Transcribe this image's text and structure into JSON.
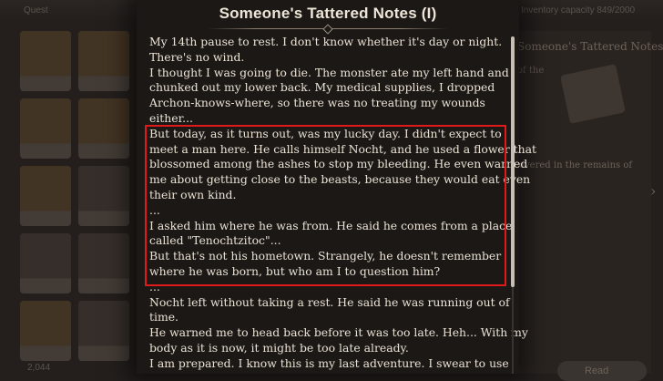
{
  "background": {
    "topbar_left": "Quest",
    "topbar_right": "Inventory capacity 849/2000",
    "detail_title": "Someone's Tattered Notes (I)",
    "detail_subtitle": "of the",
    "detail_desc": "overed in the remains of",
    "bottom_button": "Read",
    "bottom_left": "2,044"
  },
  "dialog": {
    "title": "Someone's Tattered Notes (I)",
    "lines": [
      "My 14th pause to rest. I don't know whether it's day or night.",
      "There's no wind.",
      "I thought I was going to die. The monster ate my left hand and",
      "chunked out my lower back. My medical supplies, I dropped",
      "Archon-knows-where, so there was no treating my wounds",
      "either...",
      "But today, as it turns out, was my lucky day. I didn't expect to",
      "meet a man here. He calls himself Nocht, and he used a flower that",
      "blossomed among the ashes to stop my bleeding. He even warned",
      "me about getting close to the beasts, because they would eat even",
      "their own kind.",
      "...",
      "I asked him where he was from. He said he comes from a place",
      "called \"Tenochtzitoc\"...",
      "But that's not his hometown. Strangely, he doesn't remember",
      "where he was born, but who am I to question him?",
      "...",
      "Nocht left without taking a rest. He said he was running out of",
      "time.",
      "He warned me to head back before it was too late. Heh... With my",
      "body as it is now, it might be too late already.",
      "I am prepared. I know this is my last adventure. I swear to use"
    ]
  },
  "colors": {
    "highlight": "#e01a1a",
    "text": "#ebe3d6",
    "panel": "#1c1816"
  },
  "icons": {
    "divider": "diamond-ornament-icon",
    "chevron": "chevron-right-icon"
  }
}
